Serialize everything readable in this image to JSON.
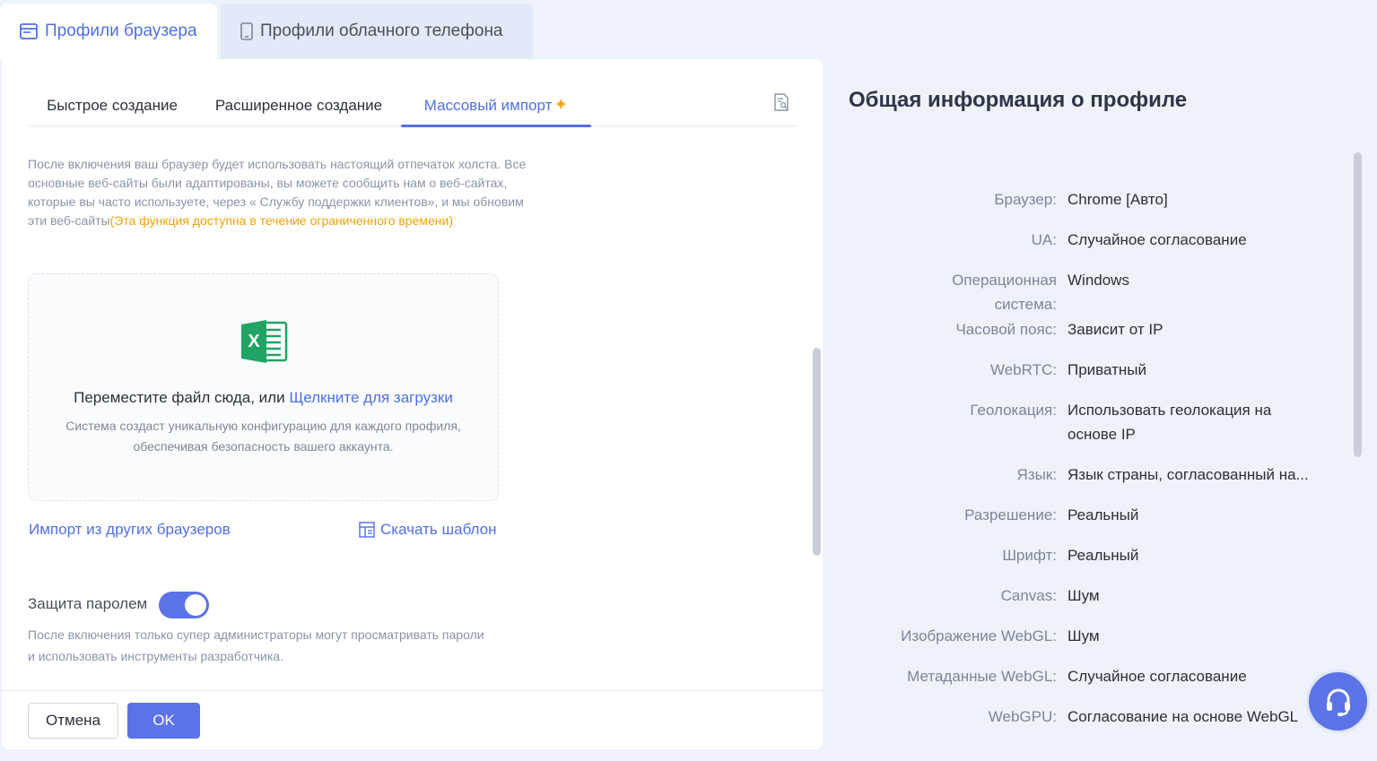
{
  "top_tabs": [
    {
      "label": "Профили браузера",
      "icon": "browser-window-icon"
    },
    {
      "label": "Профили облачного телефона",
      "icon": "phone-icon"
    }
  ],
  "sub_tabs": {
    "quick": "Быстрое создание",
    "advanced": "Расширенное создание",
    "bulk": "Массовый импорт"
  },
  "notice": {
    "text": "После включения ваш браузер будет использовать настоящий отпечаток холста. Все основные веб-сайты были адаптированы, вы можете сообщить нам о веб-сайтах, которые вы часто используете, через « Службу поддержки клиентов», и мы обновим эти веб-сайты",
    "highlight": "(Эта функция доступна в течение ограниченного времени)"
  },
  "dropzone": {
    "main": "Переместите файл сюда, или ",
    "link": "Щелкните для загрузки",
    "sub": "Система создаст уникальную конфигурацию для каждого профиля, обеспечивая безопасность вашего аккаунта."
  },
  "links": {
    "import_other": "Импорт из других браузеров",
    "download_template": "Скачать шаблон"
  },
  "password": {
    "label": "Защита паролем",
    "enabled": true,
    "note": "После включения только супер администраторы могут просматривать пароли и использовать инструменты разработчика."
  },
  "buttons": {
    "cancel": "Отмена",
    "ok": "OK"
  },
  "colors": {
    "accent": "#4f6fe8",
    "highlight": "#f0a20a",
    "excel": "#1fa463"
  },
  "summary": {
    "title": "Общая информация о профиле",
    "rows": [
      {
        "label": "Браузер:",
        "value": "Chrome [Авто]"
      },
      {
        "label": "UA:",
        "value": "Случайное согласование"
      },
      {
        "label": "Операционная система:",
        "value": "Windows"
      },
      {
        "label": "Часовой пояс:",
        "value": "Зависит от IP"
      },
      {
        "label": "WebRTC:",
        "value": "Приватный"
      },
      {
        "label": "Геолокация:",
        "value": "Использовать геолокация на основе IP"
      },
      {
        "label": "Язык:",
        "value": "Язык страны, согласованный на..."
      },
      {
        "label": "Разрешение:",
        "value": "Реальный"
      },
      {
        "label": "Шрифт:",
        "value": "Реальный"
      },
      {
        "label": "Canvas:",
        "value": "Шум"
      },
      {
        "label": "Изображение WebGL:",
        "value": "Шум"
      },
      {
        "label": "Метаданные WebGL:",
        "value": "Случайное согласование"
      },
      {
        "label": "WebGPU:",
        "value": "Согласование на основе WebGL"
      }
    ]
  }
}
